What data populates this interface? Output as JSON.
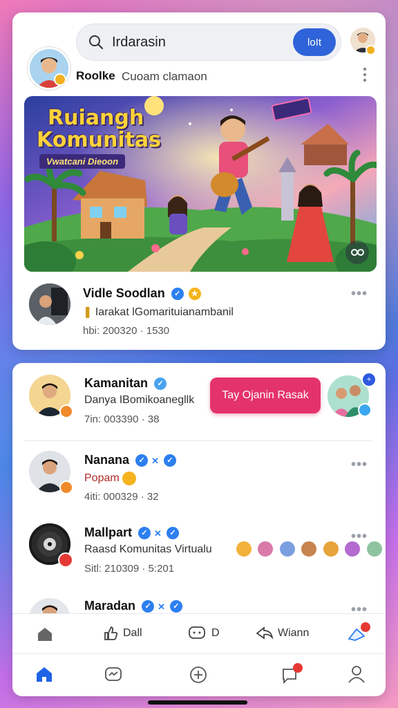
{
  "search": {
    "query": "Irdarasin",
    "button_label": "loIt"
  },
  "header": {
    "profile_name": "Roolke",
    "profile_sub": "Cuoam clamaon"
  },
  "banner": {
    "title_line1": "Ruiangh",
    "title_line2": "Komunitas",
    "tagline": "Vwatcani Dieoon"
  },
  "featured_post": {
    "name": "Vidle Soodlan",
    "description": "Iarakat lGomarituianambanil",
    "meta": "hbi: 200320 · 1530"
  },
  "members": [
    {
      "name": "Kamanitan",
      "text": "Danya IBomikoanegllk",
      "meta": "7in: 003390 · 38",
      "action_label": "Tay Ojanin Rasak"
    },
    {
      "name": "Nanana",
      "text": "Popam",
      "meta": "4iti: 000329 · 32"
    },
    {
      "name": "Mallpart",
      "text": "Raasd Komunitas Virtualu",
      "meta": "Sitl: 210309 · 5:201"
    },
    {
      "name": "Maradan"
    }
  ],
  "action_bar": {
    "items": [
      "Dall",
      "D",
      "Wiann"
    ]
  },
  "colors": {
    "accent": "#2f63d9",
    "action_button": "#e4336a",
    "verified": "#2d7ff0",
    "active_nav": "#1e63e6"
  },
  "icons": [
    "search-icon",
    "more-icon",
    "home-icon",
    "like-icon",
    "comment-icon",
    "share-icon",
    "notification-icon",
    "messenger-icon",
    "create-icon",
    "chat-icon",
    "profile-icon"
  ]
}
